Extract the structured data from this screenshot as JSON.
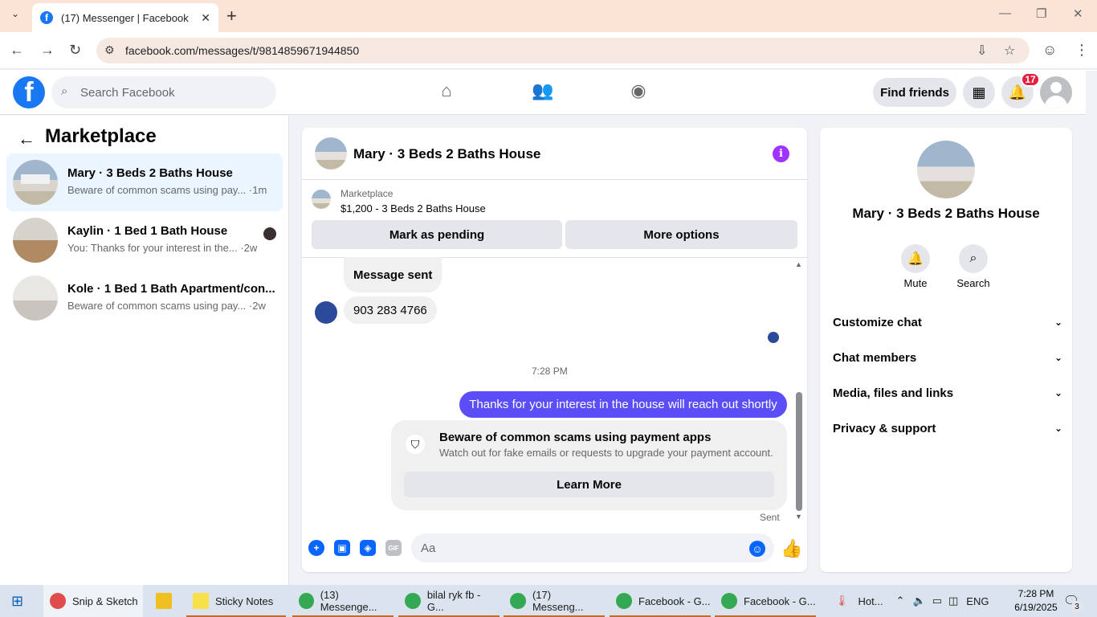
{
  "browser": {
    "tab_title": "(17) Messenger | Facebook",
    "url": "facebook.com/messages/t/9814859671944850"
  },
  "fb_header": {
    "search_placeholder": "Search Facebook",
    "find_friends": "Find friends",
    "notification_count": "17"
  },
  "left": {
    "title": "Marketplace",
    "conversations": [
      {
        "name": "Mary · 3 Beds 2 Baths House",
        "preview": "Beware of common scams using pay... ·1m",
        "active": true
      },
      {
        "name": "Kaylin · 1 Bed 1 Bath House",
        "preview": "You: Thanks for your interest in the... ·2w",
        "active": false
      },
      {
        "name": "Kole · 1 Bed 1 Bath Apartment/con...",
        "preview": "Beware of common scams using pay... ·2w",
        "active": false
      }
    ]
  },
  "chat": {
    "title": "Mary · 3 Beds 2 Baths House",
    "marketplace_label": "Marketplace",
    "listing": "$1,200 - 3 Beds 2 Baths House",
    "mark_pending": "Mark as pending",
    "more_options": "More options",
    "messages": {
      "received_1": "Message sent",
      "received_2": "903 283 4766",
      "timestamp": "7:28 PM",
      "sent": "Thanks for your interest in the house will reach out shortly",
      "warning_title": "Beware of common scams using payment apps",
      "warning_text": "Watch out for fake emails or requests to upgrade your payment account.",
      "learn_more": "Learn More",
      "status": "Sent"
    },
    "input_placeholder": "Aa"
  },
  "right": {
    "name": "Mary · 3 Beds 2 Baths House",
    "mute": "Mute",
    "search": "Search",
    "sections": [
      "Customize chat",
      "Chat members",
      "Media, files and links",
      "Privacy & support"
    ]
  },
  "taskbar": {
    "apps": [
      "Snip & Sketch",
      "Sticky Notes",
      "(13) Messenge...",
      "bilal ryk fb - G...",
      "(17) Messeng...",
      "Facebook - G...",
      "Facebook - G..."
    ],
    "weather": "Hot...",
    "lang": "ENG",
    "time": "7:28 PM",
    "date": "6/19/2025",
    "notif": "3"
  }
}
